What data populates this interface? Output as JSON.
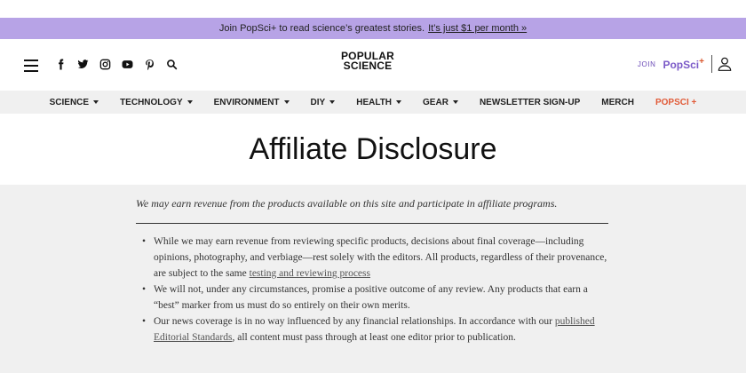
{
  "promo": {
    "lead": "Join PopSci+ to read science’s greatest stories.",
    "link": "It’s just $1 per month »"
  },
  "header": {
    "socials": [
      "facebook-icon",
      "twitter-icon",
      "instagram-icon",
      "youtube-icon",
      "pinterest-icon",
      "search-icon"
    ],
    "logo_line1": "POPULAR",
    "logo_line2": "SCIENCE",
    "join": "JOIN",
    "popsci": "PopSci",
    "popsci_plus": "+",
    "accent": "#7b5ac8",
    "promo_bg": "#b7a3e6"
  },
  "nav": {
    "items": [
      {
        "label": "SCIENCE",
        "dropdown": true
      },
      {
        "label": "TECHNOLOGY",
        "dropdown": true
      },
      {
        "label": "ENVIRONMENT",
        "dropdown": true
      },
      {
        "label": "DIY",
        "dropdown": true
      },
      {
        "label": "HEALTH",
        "dropdown": true
      },
      {
        "label": "GEAR",
        "dropdown": true
      },
      {
        "label": "NEWSLETTER SIGN-UP",
        "dropdown": false
      },
      {
        "label": "MERCH",
        "dropdown": false
      },
      {
        "label": "POPSCI +",
        "dropdown": false
      }
    ]
  },
  "page": {
    "title": "Affiliate Disclosure",
    "intro": "We may earn revenue from the products available on this site and participate in affiliate programs.",
    "bullets": [
      {
        "text": "While we may earn revenue from reviewing specific products, decisions about final coverage—including opinions, photography, and verbiage—rest solely with the editors. All products, regardless of their provenance, are subject to the same ",
        "link": "testing and reviewing process",
        "after": ""
      },
      {
        "text": "We will not, under any circumstances, promise a positive outcome of any review. Any products that earn a “best” marker from us must do so entirely on their own merits.",
        "link": "",
        "after": ""
      },
      {
        "text": "Our news coverage is in no way influenced by any financial relationships. In accordance with our ",
        "link": "published Editorial Standards",
        "after": ", all content must pass through at least one editor prior to publication."
      }
    ]
  }
}
